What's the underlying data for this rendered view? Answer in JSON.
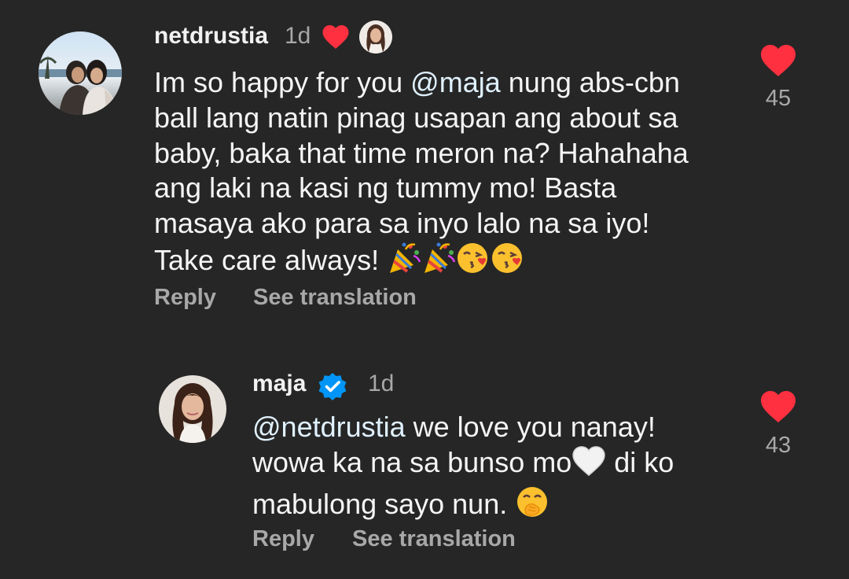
{
  "comments": [
    {
      "username": "netdrustia",
      "time": "1d",
      "lines": [
        [
          "Im so happy for you ",
          "@maja",
          " nung abs-cbn"
        ],
        [
          "ball lang natin pinag usapan ang about sa"
        ],
        [
          "baby, baka that time meron na? Hahahaha"
        ],
        [
          "ang laki na kasi ng tummy mo! Basta"
        ],
        [
          "masaya ako para sa inyo lalo na sa iyo!"
        ],
        [
          "Take care always! "
        ]
      ],
      "like_count": "45",
      "reply_label": "Reply",
      "translate_label": "See translation",
      "icons": [
        "heart-liked-by-author-icon",
        "author-mini-avatar",
        "party-popper-emoji",
        "party-popper-emoji",
        "kissing-heart-emoji",
        "kissing-heart-emoji"
      ]
    },
    {
      "username": "maja",
      "time": "1d",
      "lines": [
        [
          "",
          "@netdrustia",
          " we love you nanay!"
        ],
        [
          "wowa ka na sa bunso mo",
          "",
          " di ko"
        ],
        [
          "mabulong sayo nun. "
        ]
      ],
      "like_count": "43",
      "reply_label": "Reply",
      "translate_label": "See translation",
      "icons": [
        "verified-badge-icon",
        "white-heart-emoji",
        "hand-over-mouth-emoji"
      ]
    }
  ],
  "colors": {
    "background": "#262626",
    "heart": "#ff3040",
    "verified": "#0095f6",
    "secondary_text": "#a8a8a8"
  }
}
